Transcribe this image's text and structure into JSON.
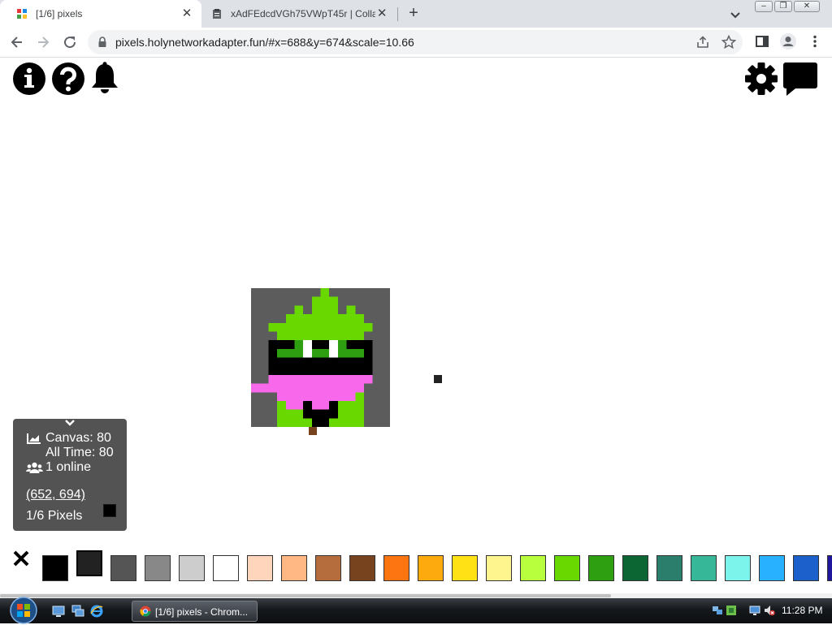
{
  "browser": {
    "tabs": [
      {
        "title": "[1/6] pixels",
        "active": true
      },
      {
        "title": "xAdFEdcdVGh75VWpT45r | Colla",
        "active": false
      }
    ],
    "new_tab_symbol": "+",
    "close_symbol": "✕",
    "url": "pixels.holynetworkadapter.fun/#x=688&y=674&scale=10.66"
  },
  "page": {
    "stats": {
      "canvas_label": "Canvas: 80",
      "alltime_label": "All Time: 80",
      "online_label": "1 online",
      "coords": "(652, 694)",
      "pixels_label": "1/6 Pixels"
    },
    "palette_colors": [
      "#000000",
      "#222222",
      "#555555",
      "#888888",
      "#cdcdcd",
      "#ffffff",
      "#ffd5bc",
      "#ffb783",
      "#b66d3d",
      "#77431f",
      "#fc7510",
      "#fcaa0d",
      "#ffe115",
      "#fff58f",
      "#b8ff3d",
      "#69d700",
      "#2e9f11",
      "#0c6633",
      "#2b7e6c",
      "#36b798",
      "#7cf4ec",
      "#27b1fe",
      "#1c61cb",
      "#21169e"
    ],
    "selected_color_index": 1,
    "current_color": "#000000",
    "colors": {
      "background": "#5c5c5c",
      "green": "#69d700",
      "dark_green": "#2e9f11",
      "pink": "#f769ea",
      "black": "#000000",
      "white": "#ffffff",
      "brown": "#77431f"
    }
  },
  "taskbar": {
    "chrome_task_label": "[1/6] pixels - Chrom...",
    "clock": "11:28 PM"
  }
}
